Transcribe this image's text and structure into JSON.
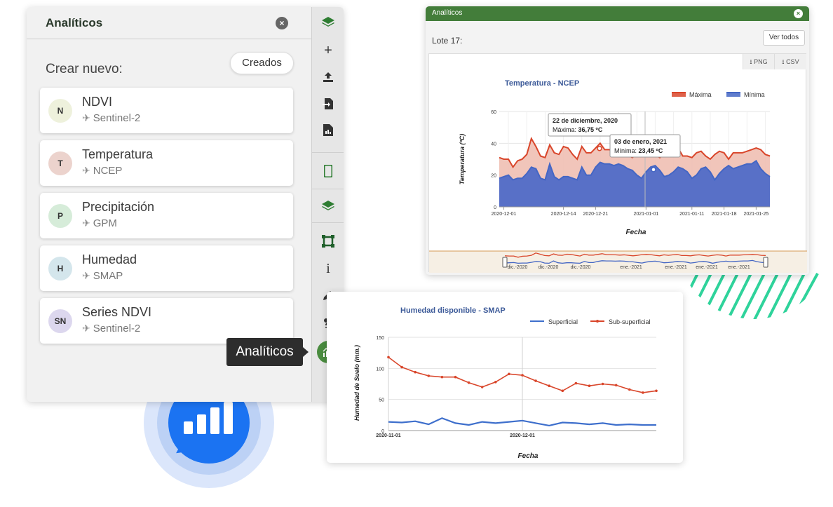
{
  "left_panel": {
    "title": "Analíticos",
    "close_glyph": "×",
    "crear_nuevo": "Crear nuevo:",
    "creados_label": "Creados",
    "cards": [
      {
        "initials": "N",
        "name": "NDVI",
        "source": "Sentinel-2",
        "avatar_color": "#eef1dc"
      },
      {
        "initials": "T",
        "name": "Temperatura",
        "source": "NCEP",
        "avatar_color": "#ecd3cd"
      },
      {
        "initials": "P",
        "name": "Precipitación",
        "source": "GPM",
        "avatar_color": "#d6ecd9"
      },
      {
        "initials": "H",
        "name": "Humedad",
        "source": "SMAP",
        "avatar_color": "#d4e6ec"
      },
      {
        "initials": "SN",
        "name": "Series NDVI",
        "source": "Sentinel-2",
        "avatar_color": "#dcd7ee"
      }
    ],
    "tooltip": "Analíticos",
    "toolbar_icons": [
      "layers-icon",
      "add-icon",
      "upload-icon",
      "import-file-icon",
      "report-icon",
      "mobile-icon",
      "layers-icon",
      "polygon-icon",
      "info-icon",
      "edit-icon",
      "weather-icon",
      "analytics-icon"
    ]
  },
  "temp_window": {
    "title": "Analíticos",
    "close_glyph": "×",
    "lote": "Lote 17:",
    "ver_todos": "Ver todos",
    "export_png": "PNG",
    "export_csv": "CSV",
    "tooltip1_title": "22 de diciembre, 2020",
    "tooltip1_label": "Máxima: ",
    "tooltip1_value": "36,75 ºC",
    "tooltip2_title": "03 de enero, 2021",
    "tooltip2_label": "Mínima: ",
    "tooltip2_value": "23,45 ºC",
    "navigator_labels": [
      "dic.-2020",
      "dic.-2020",
      "dic.-2020",
      "ene.-2021",
      "ene.-2021",
      "ene.-2021",
      "ene.-2021"
    ]
  },
  "chart_data": [
    {
      "type": "area",
      "title": "Temperatura - NCEP",
      "xlabel": "Fecha",
      "ylabel": "Temperatura (ºC)",
      "ylim": [
        0,
        60
      ],
      "yticks": [
        0,
        20,
        40,
        60
      ],
      "xticks": [
        "2020-12-01",
        "2020-12-14",
        "2020-12-21",
        "2021-01-01",
        "2021-01-11",
        "2021-01-18",
        "2021-01-25"
      ],
      "x_start": "2020-11-30",
      "x_end": "2021-01-28",
      "legend_position": "top-right",
      "series": [
        {
          "name": "Máxima",
          "color": "#d9462b",
          "values": [
            31,
            30,
            30,
            25,
            29,
            30,
            33,
            43,
            38,
            32,
            31,
            39,
            34,
            33,
            38,
            37,
            33,
            30,
            38,
            34,
            34,
            37,
            40,
            36,
            36,
            35,
            34,
            35,
            33,
            31,
            33,
            36,
            37,
            36,
            33,
            31,
            35,
            33,
            35,
            37,
            32,
            32,
            31,
            34,
            35,
            32,
            30,
            33,
            35,
            34,
            30,
            34,
            34,
            34,
            35,
            36,
            37,
            36,
            33,
            32
          ]
        },
        {
          "name": "Mínima",
          "color": "#4466c4",
          "values": [
            18,
            19,
            20,
            17,
            18,
            18,
            21,
            25,
            24,
            18,
            17,
            27,
            19,
            17,
            19,
            19,
            18,
            17,
            25,
            20,
            20,
            25,
            28,
            27,
            27,
            26,
            27,
            26,
            24,
            23,
            20,
            18,
            22,
            25,
            26,
            23,
            19,
            20,
            22,
            25,
            24,
            22,
            18,
            20,
            24,
            25,
            22,
            17,
            21,
            24,
            26,
            24,
            25,
            26,
            27,
            27,
            29,
            24,
            21,
            19
          ]
        }
      ]
    },
    {
      "type": "line",
      "title": "Humedad disponible - SMAP",
      "xlabel": "Fecha",
      "ylabel": "Humedad de Suelo (mm.)",
      "ylim": [
        0,
        150
      ],
      "yticks": [
        0,
        50,
        100,
        150
      ],
      "xticks": [
        "2020-11-01",
        "2020-12-01"
      ],
      "x_start": "2020-11-01",
      "x_end": "2020-12-31",
      "legend_position": "top-right",
      "series": [
        {
          "name": "Superficial",
          "color": "#3e6fcc",
          "x": [
            "2020-11-01",
            "2020-11-04",
            "2020-11-07",
            "2020-11-10",
            "2020-11-13",
            "2020-11-16",
            "2020-11-19",
            "2020-11-22",
            "2020-11-25",
            "2020-11-28",
            "2020-12-01",
            "2020-12-04",
            "2020-12-07",
            "2020-12-10",
            "2020-12-13",
            "2020-12-16",
            "2020-12-19",
            "2020-12-22",
            "2020-12-25",
            "2020-12-28",
            "2020-12-31"
          ],
          "values": [
            14,
            13,
            15,
            10,
            20,
            12,
            9,
            14,
            12,
            14,
            16,
            12,
            8,
            13,
            12,
            10,
            12,
            9,
            10,
            9,
            9
          ]
        },
        {
          "name": "Sub-superficial",
          "color": "#d9462b",
          "x": [
            "2020-11-01",
            "2020-11-04",
            "2020-11-07",
            "2020-11-10",
            "2020-11-13",
            "2020-11-16",
            "2020-11-19",
            "2020-11-22",
            "2020-11-25",
            "2020-11-28",
            "2020-12-01",
            "2020-12-04",
            "2020-12-07",
            "2020-12-10",
            "2020-12-13",
            "2020-12-16",
            "2020-12-19",
            "2020-12-22",
            "2020-12-25",
            "2020-12-28",
            "2020-12-31"
          ],
          "values": [
            118,
            102,
            94,
            88,
            86,
            86,
            77,
            70,
            78,
            91,
            89,
            80,
            72,
            64,
            76,
            72,
            75,
            73,
            66,
            61,
            64
          ]
        }
      ]
    }
  ]
}
